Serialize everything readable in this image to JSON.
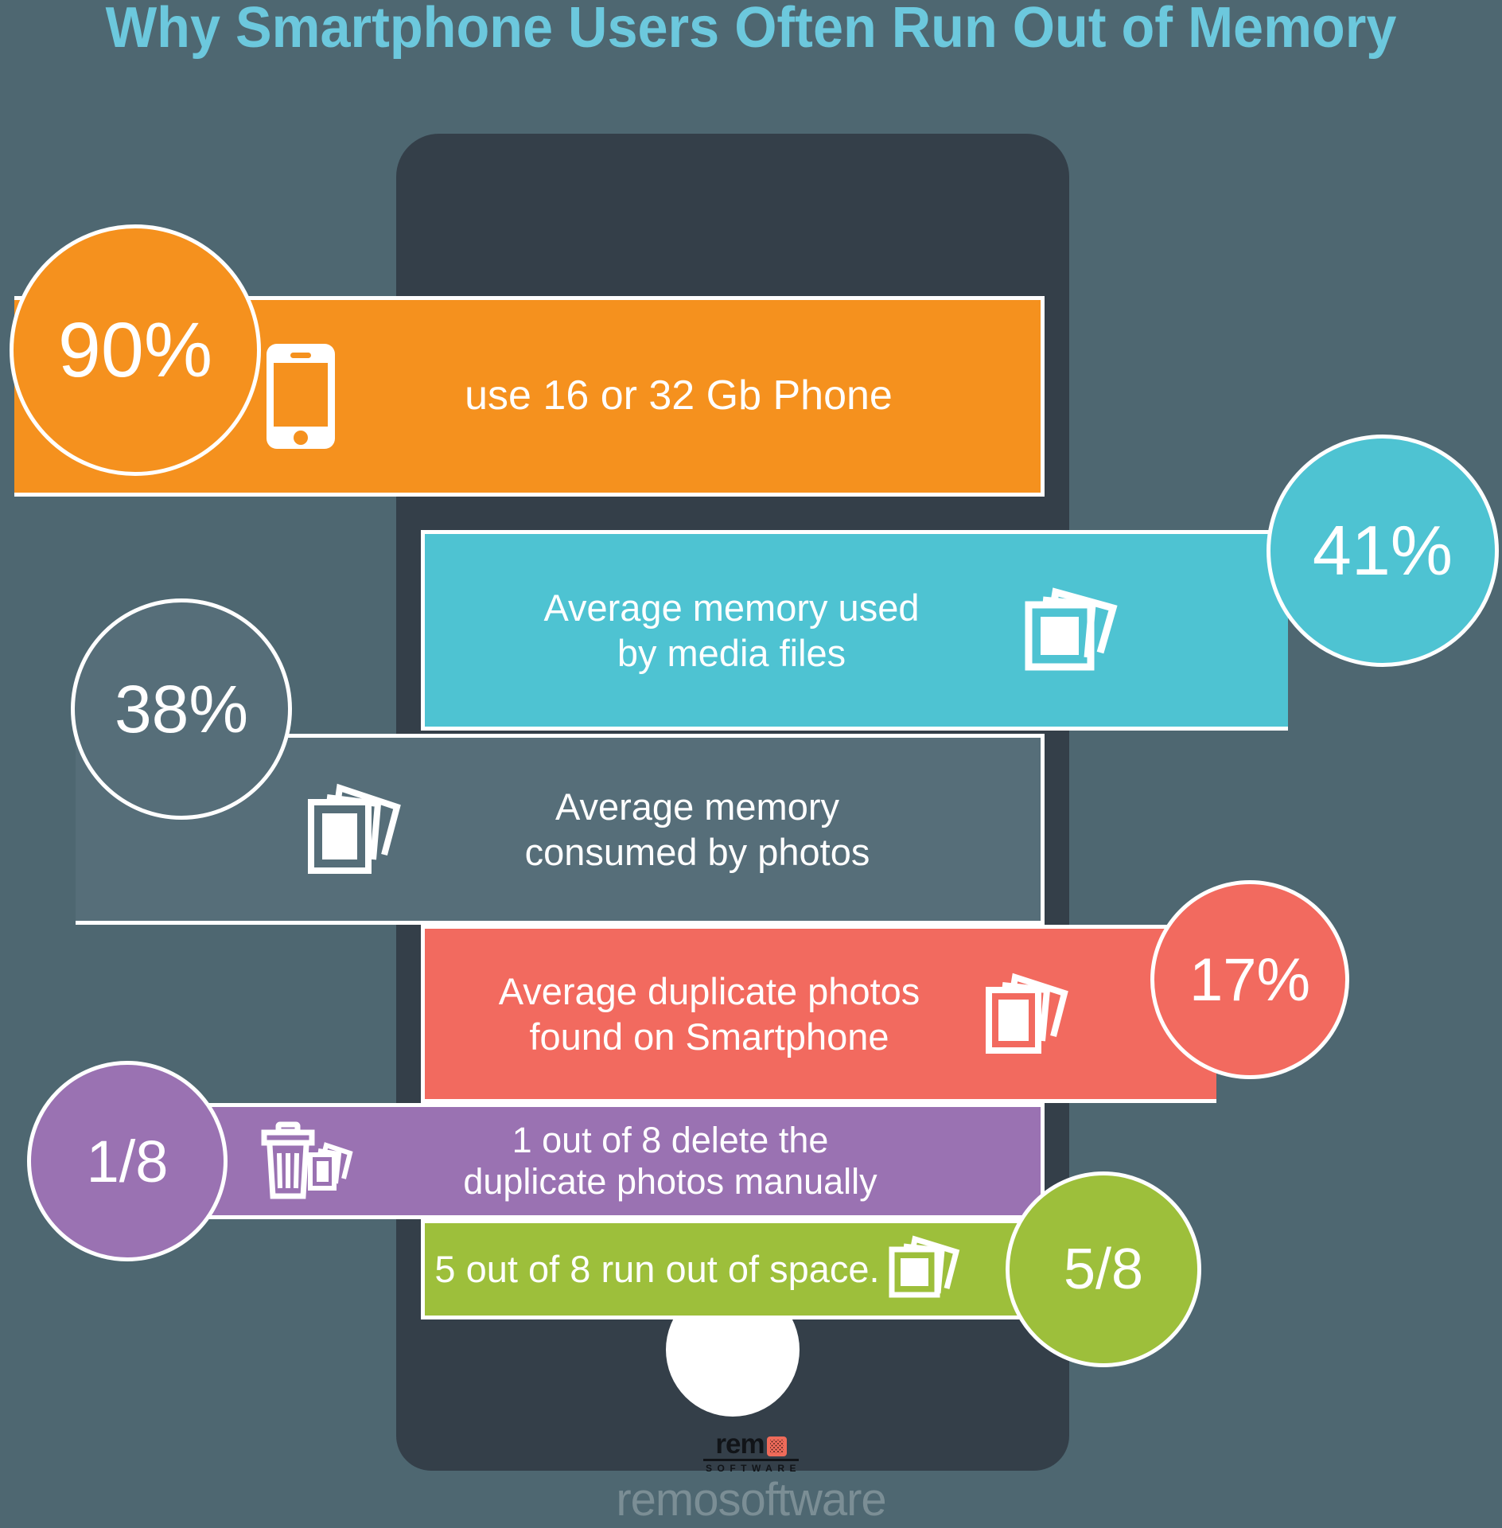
{
  "title": "Why Smartphone Users Often Run Out of Memory",
  "colors": {
    "background": "#4e6771",
    "phone_body": "#343f49",
    "title": "#6cc8dd",
    "orange": "#f5911e",
    "cyan": "#4ec3d2",
    "slate": "#566e79",
    "red": "#f26a5f",
    "purple": "#9a72b2",
    "green": "#9dbf3b",
    "white": "#ffffff",
    "logo_accent": "#ef6b5a"
  },
  "phone": {
    "camera_icon": "camera-dot",
    "speaker_icon": "speaker-slot",
    "home_button_icon": "home-button"
  },
  "chart_data": {
    "type": "bar",
    "title": "Why Smartphone Users Often Run Out of Memory",
    "categories": [
      "use 16 or 32 Gb Phone",
      "Average memory used by media files",
      "Average memory consumed by photos",
      "Average duplicate photos found on Smartphone",
      "1 out of 8 delete the duplicate photos manually",
      "5 out of 8 run out of space."
    ],
    "values": [
      90,
      41,
      38,
      17,
      12.5,
      62.5
    ],
    "value_labels": [
      "90%",
      "41%",
      "38%",
      "17%",
      "1/8",
      "5/8"
    ],
    "colors": [
      "#f5911e",
      "#4ec3d2",
      "#566e79",
      "#f26a5f",
      "#9a72b2",
      "#9dbf3b"
    ],
    "xlabel": "",
    "ylabel": "",
    "grid": false,
    "legend": "none"
  },
  "rows": [
    {
      "id": "row-16-32gb",
      "value": "90%",
      "text": "use 16 or 32 Gb Phone",
      "color": "#f5911e",
      "icon": "smartphone-icon",
      "side": "left"
    },
    {
      "id": "row-media-files",
      "value": "41%",
      "text": "Average memory used\nby media files",
      "color": "#4ec3d2",
      "icon": "photo-stack-icon",
      "side": "right"
    },
    {
      "id": "row-photos",
      "value": "38%",
      "text": "Average memory\nconsumed by photos",
      "color": "#566e79",
      "icon": "photo-stack-icon",
      "side": "left"
    },
    {
      "id": "row-duplicates",
      "value": "17%",
      "text": "Average duplicate photos\nfound on Smartphone",
      "color": "#f26a5f",
      "icon": "photo-stack-icon",
      "side": "right"
    },
    {
      "id": "row-manual-delete",
      "value": "1/8",
      "text": "1 out of 8 delete the\nduplicate photos manually",
      "color": "#9a72b2",
      "icon": "trash-photos-icon",
      "side": "left"
    },
    {
      "id": "row-out-of-space",
      "value": "5/8",
      "text": "5 out of 8 run out of space.",
      "color": "#9dbf3b",
      "icon": "photo-stack-icon",
      "side": "right"
    }
  ],
  "footer": {
    "logo_text": "rem",
    "logo_mark_icon": "remo-o-square-icon",
    "logo_subtitle": "SOFTWARE",
    "watermark": "remosoftware"
  }
}
